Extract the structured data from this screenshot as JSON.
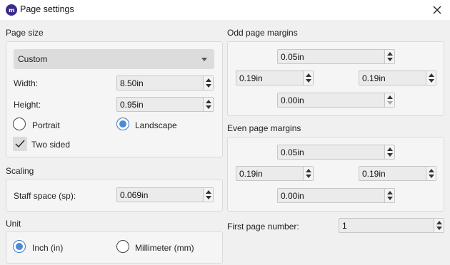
{
  "window": {
    "title": "Page settings",
    "logo_text": "m"
  },
  "page_size": {
    "section_title": "Page size",
    "preset_value": "Custom",
    "width_label": "Width:",
    "width_value": "8.50in",
    "height_label": "Height:",
    "height_value": "0.95in",
    "orientation": {
      "portrait_label": "Portrait",
      "landscape_label": "Landscape",
      "selected": "Landscape"
    },
    "two_sided_label": "Two sided",
    "two_sided_checked": true
  },
  "scaling": {
    "section_title": "Scaling",
    "staff_space_label": "Staff space (sp):",
    "staff_space_value": "0.069in"
  },
  "unit": {
    "section_title": "Unit",
    "inch_label": "Inch (in)",
    "mm_label": "Millimeter (mm)",
    "selected": "Inch (in)"
  },
  "odd_margins": {
    "section_title": "Odd page margins",
    "top": "0.05in",
    "left": "0.19in",
    "right": "0.19in",
    "bottom": "0.00in"
  },
  "even_margins": {
    "section_title": "Even page margins",
    "top": "0.05in",
    "left": "0.19in",
    "right": "0.19in",
    "bottom": "0.00in"
  },
  "first_page": {
    "label": "First page number:",
    "value": "1"
  },
  "colors": {
    "accent": "#4c8ad6",
    "logo": "#3a2b8c",
    "dialog_bg": "#f0f0f0"
  }
}
